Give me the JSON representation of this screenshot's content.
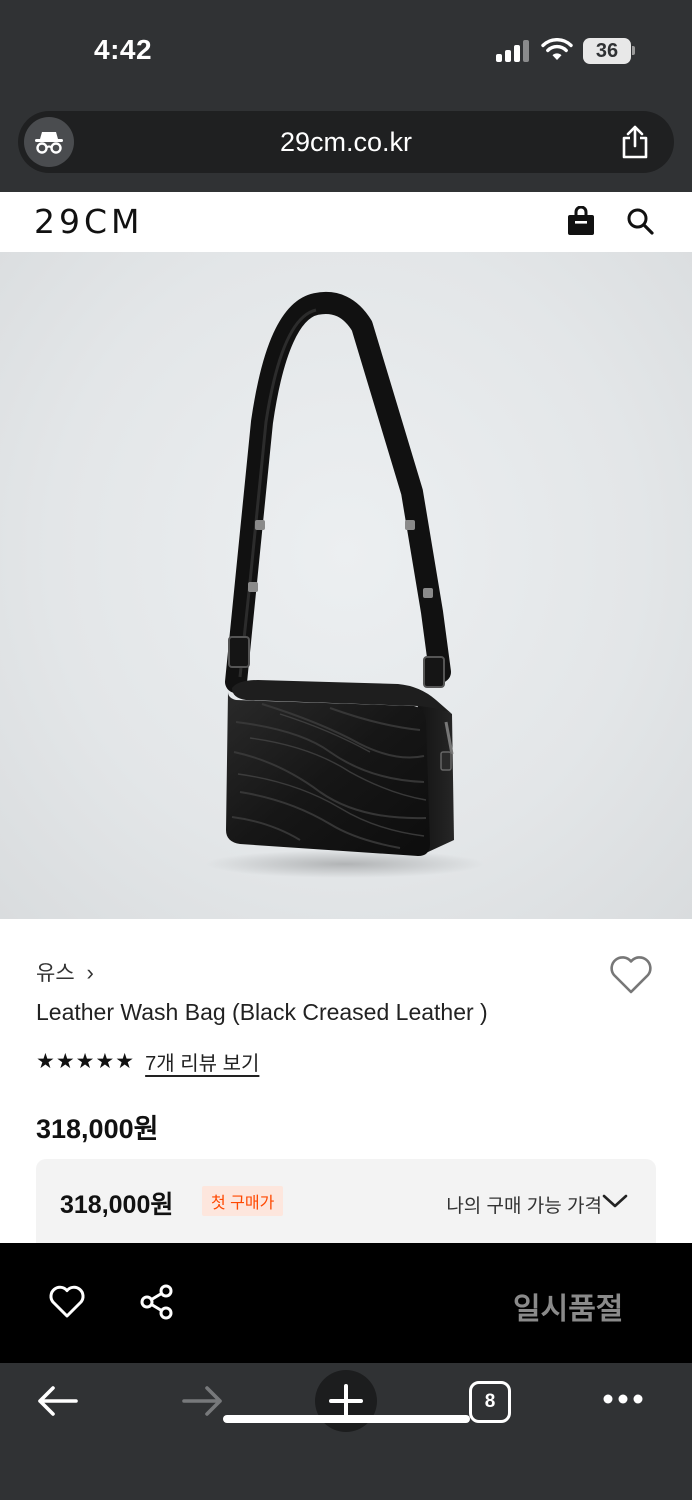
{
  "status_bar": {
    "time": "4:42",
    "battery": "36",
    "signal_icon": "cellular-signal-icon",
    "wifi_icon": "wifi-icon"
  },
  "browser": {
    "url": "29cm.co.kr",
    "incognito_icon": "incognito-icon",
    "share_icon": "share-icon"
  },
  "site_header": {
    "logo": "29CM",
    "cart_icon": "shopping-bag-icon",
    "search_icon": "search-icon"
  },
  "product": {
    "brand": "유스",
    "brand_chevron": "›",
    "title": "Leather Wash Bag (Black Creased Leather )",
    "stars": "★★★★★",
    "review_link": "7개 리뷰 보기",
    "price": "318,000원",
    "benefit_price": "318,000원",
    "first_purchase_badge": "첫 구매가",
    "my_price_link": "나의 구매 가능 가격",
    "image_subject": "black creased leather shoulder bag"
  },
  "action_bar": {
    "wish_icon": "heart-outline-icon",
    "share_icon": "share-nodes-icon",
    "soldout_label": "일시품절"
  },
  "browser_toolbar": {
    "back_icon": "arrow-left-icon",
    "forward_icon": "arrow-right-icon",
    "new_tab_icon": "plus-icon",
    "tab_count": "8",
    "more_icon": "more-dots-icon"
  },
  "colors": {
    "chrome_bg": "#303234",
    "badge_text": "#ff4800",
    "badge_bg": "#fde6dd",
    "soldout_text": "#8a8a8a"
  }
}
